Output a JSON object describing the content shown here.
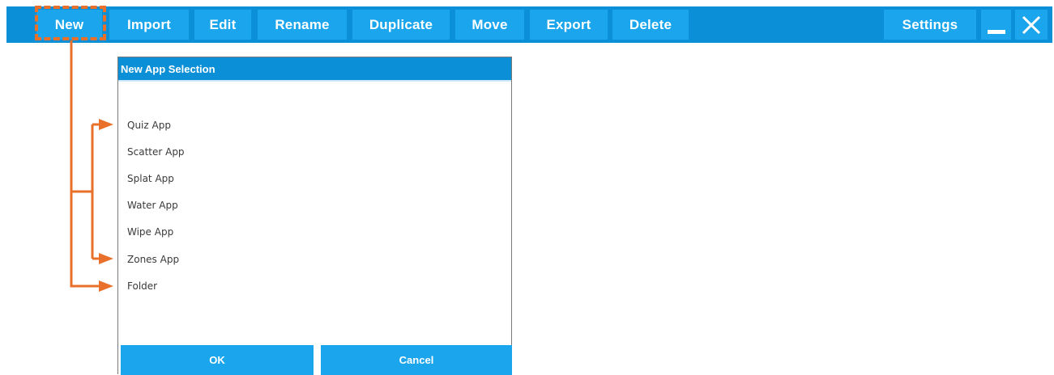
{
  "toolbar": {
    "buttons": [
      "New",
      "Import",
      "Edit",
      "Rename",
      "Duplicate",
      "Move",
      "Export",
      "Delete"
    ],
    "settings_label": "Settings"
  },
  "dialog": {
    "title": "New App Selection",
    "options": [
      "Quiz App",
      "Scatter App",
      "Splat App",
      "Water App",
      "Wipe App",
      "Zones App",
      "Folder"
    ],
    "ok_label": "OK",
    "cancel_label": "Cancel"
  },
  "icons": {
    "minimize": "minimize-icon",
    "close": "close-icon"
  },
  "colors": {
    "toolbar_bg": "#0b8fd6",
    "button_bg": "#1aa5ec",
    "annotation": "#e8702a"
  }
}
